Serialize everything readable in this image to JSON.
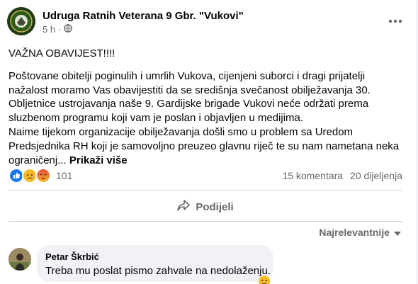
{
  "post": {
    "page_name": "Udruga Ratnih Veterana 9 Gbr. \"Vukovi\"",
    "time": "5 h",
    "privacy_sep": "·",
    "paragraphs": [
      "VAŽNA OBAVIJEST!!!!",
      "Poštovane obitelji poginulih i umrlih Vukova, cijenjeni suborci i dragi prijatelji nažalost moramo Vas obavijestiti da se središnja svečanost obilježavanja 30. Obljetnice ustrojavanja naše 9. Gardijske brigade Vukovi neće održati prema sluzbenom programu koji vam je poslan i objavljen u medijima.",
      "Naime tijekom organizacije obilježavanja došli smo u problem sa Uredom Predsjednika RH koji je samovoljno preuzeo glavnu riječ te su nam nametana neka ograničenj..."
    ],
    "see_more_label": "Prikaži više"
  },
  "reactions": {
    "count": "101",
    "icons": [
      "like-icon",
      "sad-icon",
      "angry-icon"
    ],
    "comments": "15 komentara",
    "shares": "20 dijeljenja"
  },
  "actions": {
    "share_label": "Podijeli"
  },
  "comments_section": {
    "sort_label": "Najrelevantnije",
    "items": [
      {
        "author": "Petar Škrbić",
        "text": "Treba mu poslat pismo zahvale na nedolaženju.",
        "reaction_icon": "sad-icon"
      }
    ]
  },
  "colors": {
    "accent": "#1877f2",
    "secondary_text": "#65676b",
    "bubble": "#f0f2f5"
  }
}
